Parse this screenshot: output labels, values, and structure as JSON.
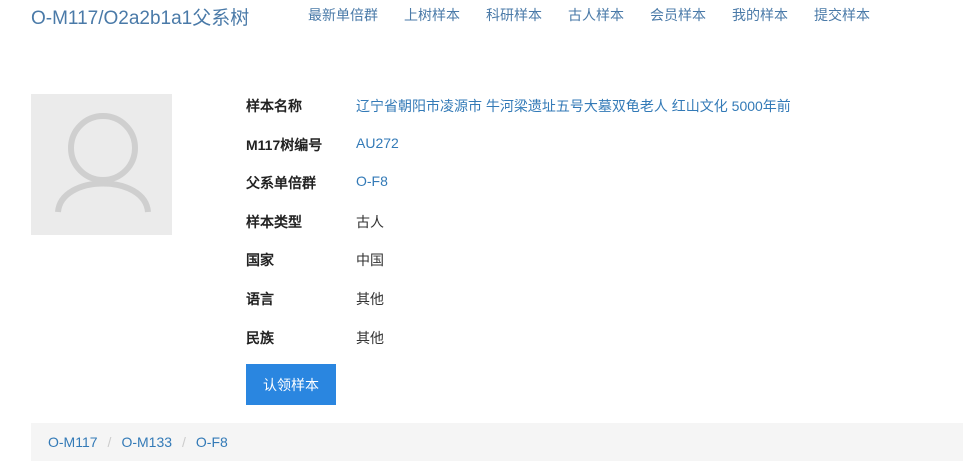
{
  "header": {
    "brand": "O-M117/O2a2b1a1父系树",
    "nav": [
      "最新单倍群",
      "上树样本",
      "科研样本",
      "古人样本",
      "会员样本",
      "我的样本",
      "提交样本"
    ]
  },
  "sample": {
    "rows": [
      {
        "label": "样本名称",
        "value": "辽宁省朝阳市凌源市 牛河梁遗址五号大墓双龟老人 红山文化 5000年前",
        "link": true
      },
      {
        "label": "M117树编号",
        "value": "AU272",
        "link": true
      },
      {
        "label": "父系单倍群",
        "value": "O-F8",
        "link": true
      },
      {
        "label": "样本类型",
        "value": "古人",
        "link": false
      },
      {
        "label": "国家",
        "value": "中国",
        "link": false
      },
      {
        "label": "语言",
        "value": "其他",
        "link": false
      },
      {
        "label": "民族",
        "value": "其他",
        "link": false
      }
    ],
    "claim_button": "认领样本"
  },
  "breadcrumb": [
    "O-M117",
    "O-M133",
    "O-F8"
  ]
}
